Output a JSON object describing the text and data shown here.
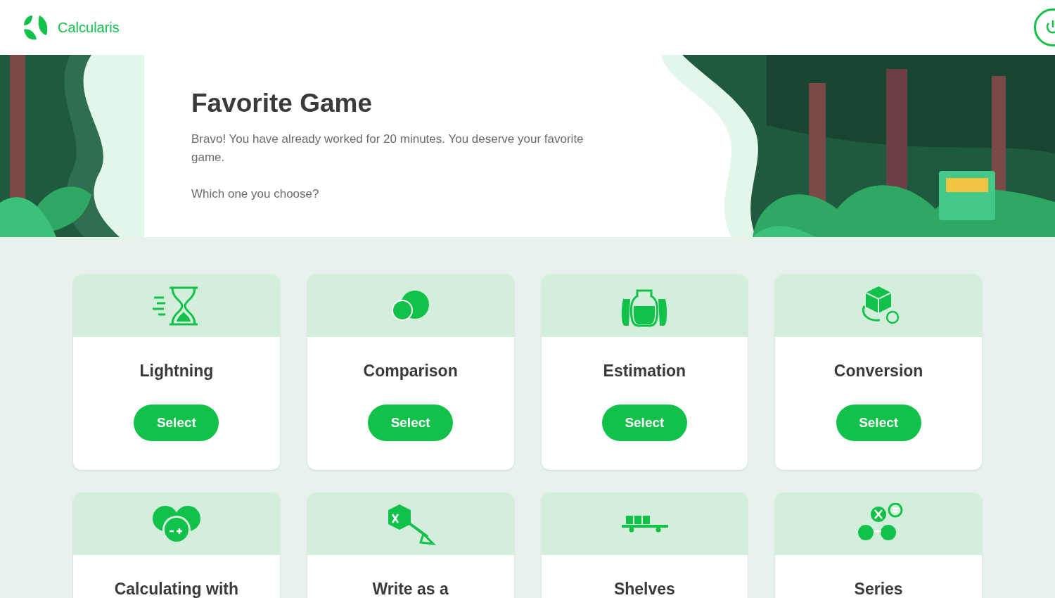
{
  "header": {
    "brand": "Calcularis"
  },
  "intro": {
    "title": "Favorite Game",
    "message": "Bravo! You have already worked for 20 minutes. You deserve your favorite game.",
    "question": "Which one you choose?"
  },
  "games": [
    {
      "kind": "hourglass",
      "title": "Lightning",
      "button": "Select"
    },
    {
      "kind": "circles",
      "title": "Comparison",
      "button": "Select"
    },
    {
      "kind": "jars",
      "title": "Estimation",
      "button": "Select"
    },
    {
      "kind": "cube",
      "title": "Conversion",
      "button": "Select"
    },
    {
      "kind": "spheres",
      "title": "Calculating with"
    },
    {
      "kind": "box-arrow",
      "title": "Write as a"
    },
    {
      "kind": "shelf",
      "title": "Shelves"
    },
    {
      "kind": "nodes",
      "title": "Series"
    }
  ]
}
